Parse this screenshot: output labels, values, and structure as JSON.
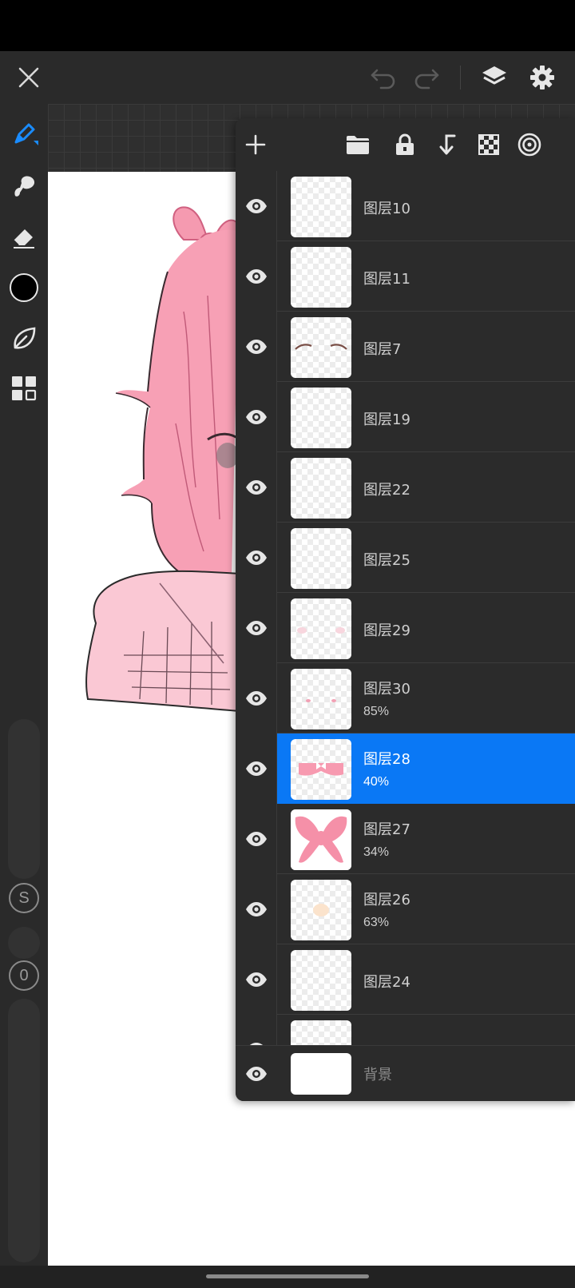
{
  "app": {
    "accent_color": "#0a78f5",
    "topbar_icons": [
      "close-icon",
      "undo-icon",
      "redo-icon",
      "layers-icon",
      "settings-icon"
    ],
    "left_tools": [
      "brush-icon",
      "smudge-icon",
      "eraser-icon",
      "color-swatch",
      "liquify-icon",
      "gallery-icon"
    ],
    "left_side_buttons": {
      "s_label": "S",
      "zero_label": "0"
    }
  },
  "layers_panel": {
    "toolbar_icons": [
      "add-layer-icon",
      "folder-icon",
      "lock-icon",
      "merge-down-icon",
      "checker-alpha-icon",
      "target-icon"
    ],
    "layers": [
      {
        "name": "图层10",
        "opacity": "",
        "selected": false,
        "thumb": "empty"
      },
      {
        "name": "图层11",
        "opacity": "",
        "selected": false,
        "thumb": "empty"
      },
      {
        "name": "图层7",
        "opacity": "",
        "selected": false,
        "thumb": "eyebrows"
      },
      {
        "name": "图层19",
        "opacity": "",
        "selected": false,
        "thumb": "empty"
      },
      {
        "name": "图层22",
        "opacity": "",
        "selected": false,
        "thumb": "empty"
      },
      {
        "name": "图层25",
        "opacity": "",
        "selected": false,
        "thumb": "empty"
      },
      {
        "name": "图层29",
        "opacity": "",
        "selected": false,
        "thumb": "faint-pink"
      },
      {
        "name": "图层30",
        "opacity": "85%",
        "selected": false,
        "thumb": "pink-dots"
      },
      {
        "name": "图层28",
        "opacity": "40%",
        "selected": true,
        "thumb": "collar"
      },
      {
        "name": "图层27",
        "opacity": "34%",
        "selected": false,
        "thumb": "bow"
      },
      {
        "name": "图层26",
        "opacity": "63%",
        "selected": false,
        "thumb": "peach"
      },
      {
        "name": "图层24",
        "opacity": "",
        "selected": false,
        "thumb": "empty"
      },
      {
        "name": "",
        "opacity": "",
        "selected": false,
        "thumb": "empty"
      }
    ],
    "background_label": "背景"
  }
}
